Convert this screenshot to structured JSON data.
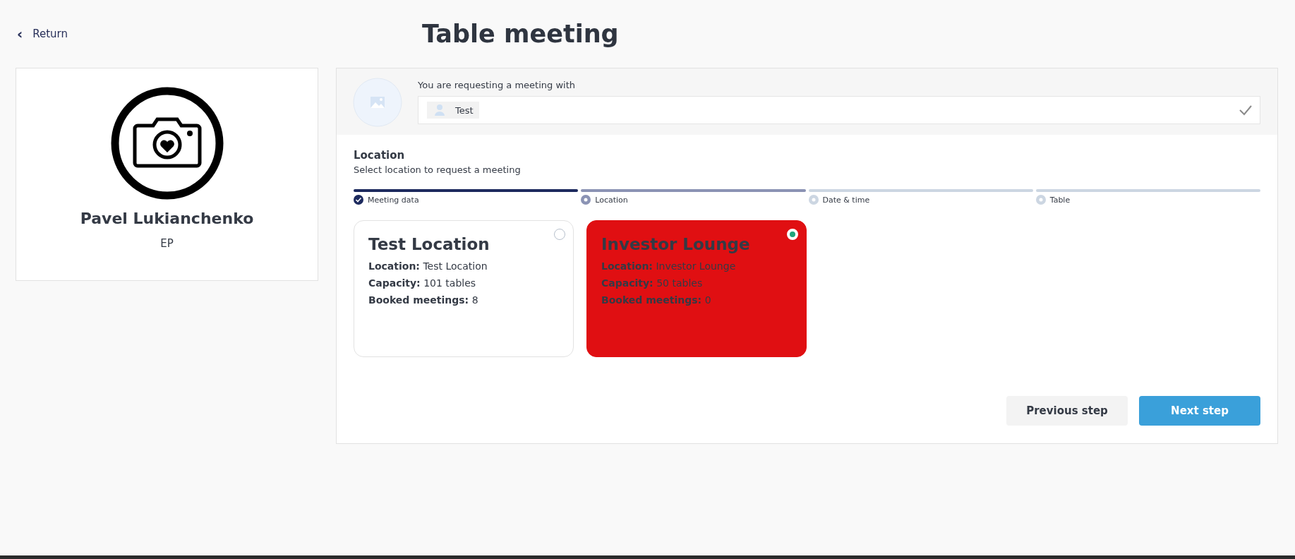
{
  "return_link": {
    "icon": "‹",
    "label": "Return"
  },
  "page_title": "Table meeting",
  "profile": {
    "name": "Pavel Lukianchenko",
    "role": "EP"
  },
  "request": {
    "label": "You are requesting a meeting with",
    "value": "Test",
    "confirmed": true
  },
  "section": {
    "title": "Location",
    "subtitle": "Select location to request a meeting"
  },
  "steps": [
    {
      "label": "Meeting data",
      "done": true,
      "current": false
    },
    {
      "label": "Location",
      "done": false,
      "current": true
    },
    {
      "label": "Date & time",
      "done": false,
      "current": false
    },
    {
      "label": "Table",
      "done": false,
      "current": false
    }
  ],
  "locations": [
    {
      "title": "Test Location",
      "selected": false,
      "rows": [
        {
          "key": "Location:",
          "value": "Test Location"
        },
        {
          "key": "Capacity:",
          "value": "101 tables"
        },
        {
          "key": "Booked meetings:",
          "value": "8"
        }
      ]
    },
    {
      "title": "Investor Lounge",
      "selected": true,
      "rows": [
        {
          "key": "Location:",
          "value": "Investor Lounge"
        },
        {
          "key": "Capacity:",
          "value": "50 tables"
        },
        {
          "key": "Booked meetings:",
          "value": "0"
        }
      ]
    }
  ],
  "buttons": {
    "previous": "Previous step",
    "next": "Next step"
  }
}
